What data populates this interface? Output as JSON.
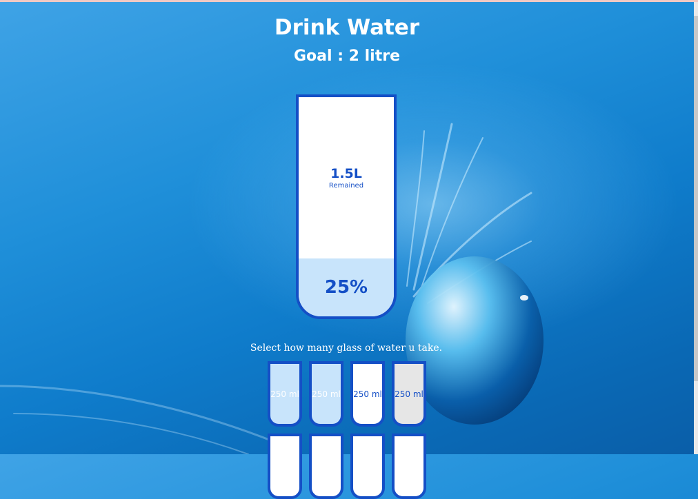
{
  "header": {
    "title": "Drink Water",
    "goal": "Goal : 2 litre"
  },
  "big_cup": {
    "remained_amount": "1.5L",
    "remained_label": "Remained",
    "percentage_text": "25%",
    "filled_fraction": 0.25
  },
  "instruction": "Select how many glass of water u take.",
  "small_cups": [
    {
      "label": "250 ml",
      "state": "full"
    },
    {
      "label": "250 ml",
      "state": "full"
    },
    {
      "label": "250 ml",
      "state": "empty"
    },
    {
      "label": "250 ml",
      "state": "hover"
    },
    {
      "label": "",
      "state": "empty"
    },
    {
      "label": "",
      "state": "empty"
    },
    {
      "label": "",
      "state": "empty"
    },
    {
      "label": "",
      "state": "empty"
    }
  ],
  "colors": {
    "accent": "#144fc6",
    "fill": "#c8e4fb",
    "background": "#1f8fd9"
  }
}
